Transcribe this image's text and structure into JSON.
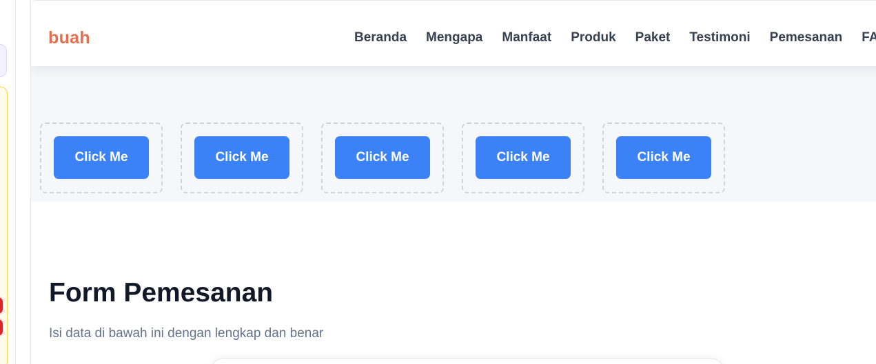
{
  "navbar": {
    "brand": "buah",
    "links": [
      "Beranda",
      "Mengapa",
      "Manfaat",
      "Produk",
      "Paket",
      "Testimoni",
      "Pemesanan",
      "FAQ"
    ]
  },
  "buttons": [
    "Click Me",
    "Click Me",
    "Click Me",
    "Click Me",
    "Click Me"
  ],
  "form": {
    "title": "Form Pemesanan",
    "subtitle": "Isi data di bawah ini dengan lengkap dan benar"
  },
  "colors": {
    "brand": "#e07150",
    "button": "#3b82f6",
    "band": "#f6f7fb",
    "text_primary": "#111827",
    "text_muted": "#64748b"
  }
}
